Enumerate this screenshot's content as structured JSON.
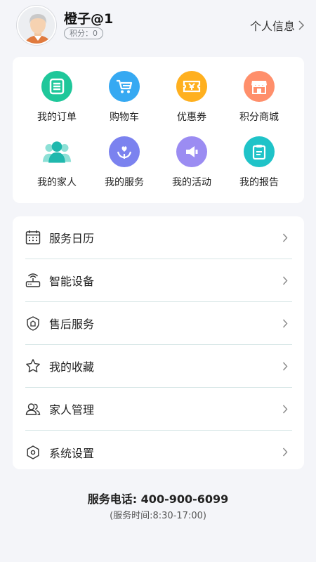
{
  "profile": {
    "username": "橙子@1",
    "points_badge": "积分：0",
    "info_link": "个人信息"
  },
  "grid": {
    "items": [
      {
        "label": "我的订单",
        "icon": "orders-icon",
        "color": "#1fc79a"
      },
      {
        "label": "购物车",
        "icon": "cart-icon",
        "color": "#36a9f2"
      },
      {
        "label": "优惠券",
        "icon": "coupon-icon",
        "color": "#ffb01f"
      },
      {
        "label": "积分商城",
        "icon": "shop-icon",
        "color": "#ff8f6b"
      },
      {
        "label": "我的家人",
        "icon": "family-icon",
        "color": "#26c2b8"
      },
      {
        "label": "我的服务",
        "icon": "service-icon",
        "color": "#7b82ef"
      },
      {
        "label": "我的活动",
        "icon": "activity-icon",
        "color": "#9b8cf2"
      },
      {
        "label": "我的报告",
        "icon": "report-icon",
        "color": "#1fc3c8"
      }
    ]
  },
  "menu": {
    "items": [
      {
        "label": "服务日历",
        "icon": "calendar-icon"
      },
      {
        "label": "智能设备",
        "icon": "router-icon"
      },
      {
        "label": "售后服务",
        "icon": "shield-icon"
      },
      {
        "label": "我的收藏",
        "icon": "star-icon"
      },
      {
        "label": "家人管理",
        "icon": "users-icon"
      },
      {
        "label": "系统设置",
        "icon": "settings-icon"
      }
    ]
  },
  "footer": {
    "hotline": "服务电话: 400-900-6099",
    "hours": "(服务时间:8:30-17:00)"
  }
}
